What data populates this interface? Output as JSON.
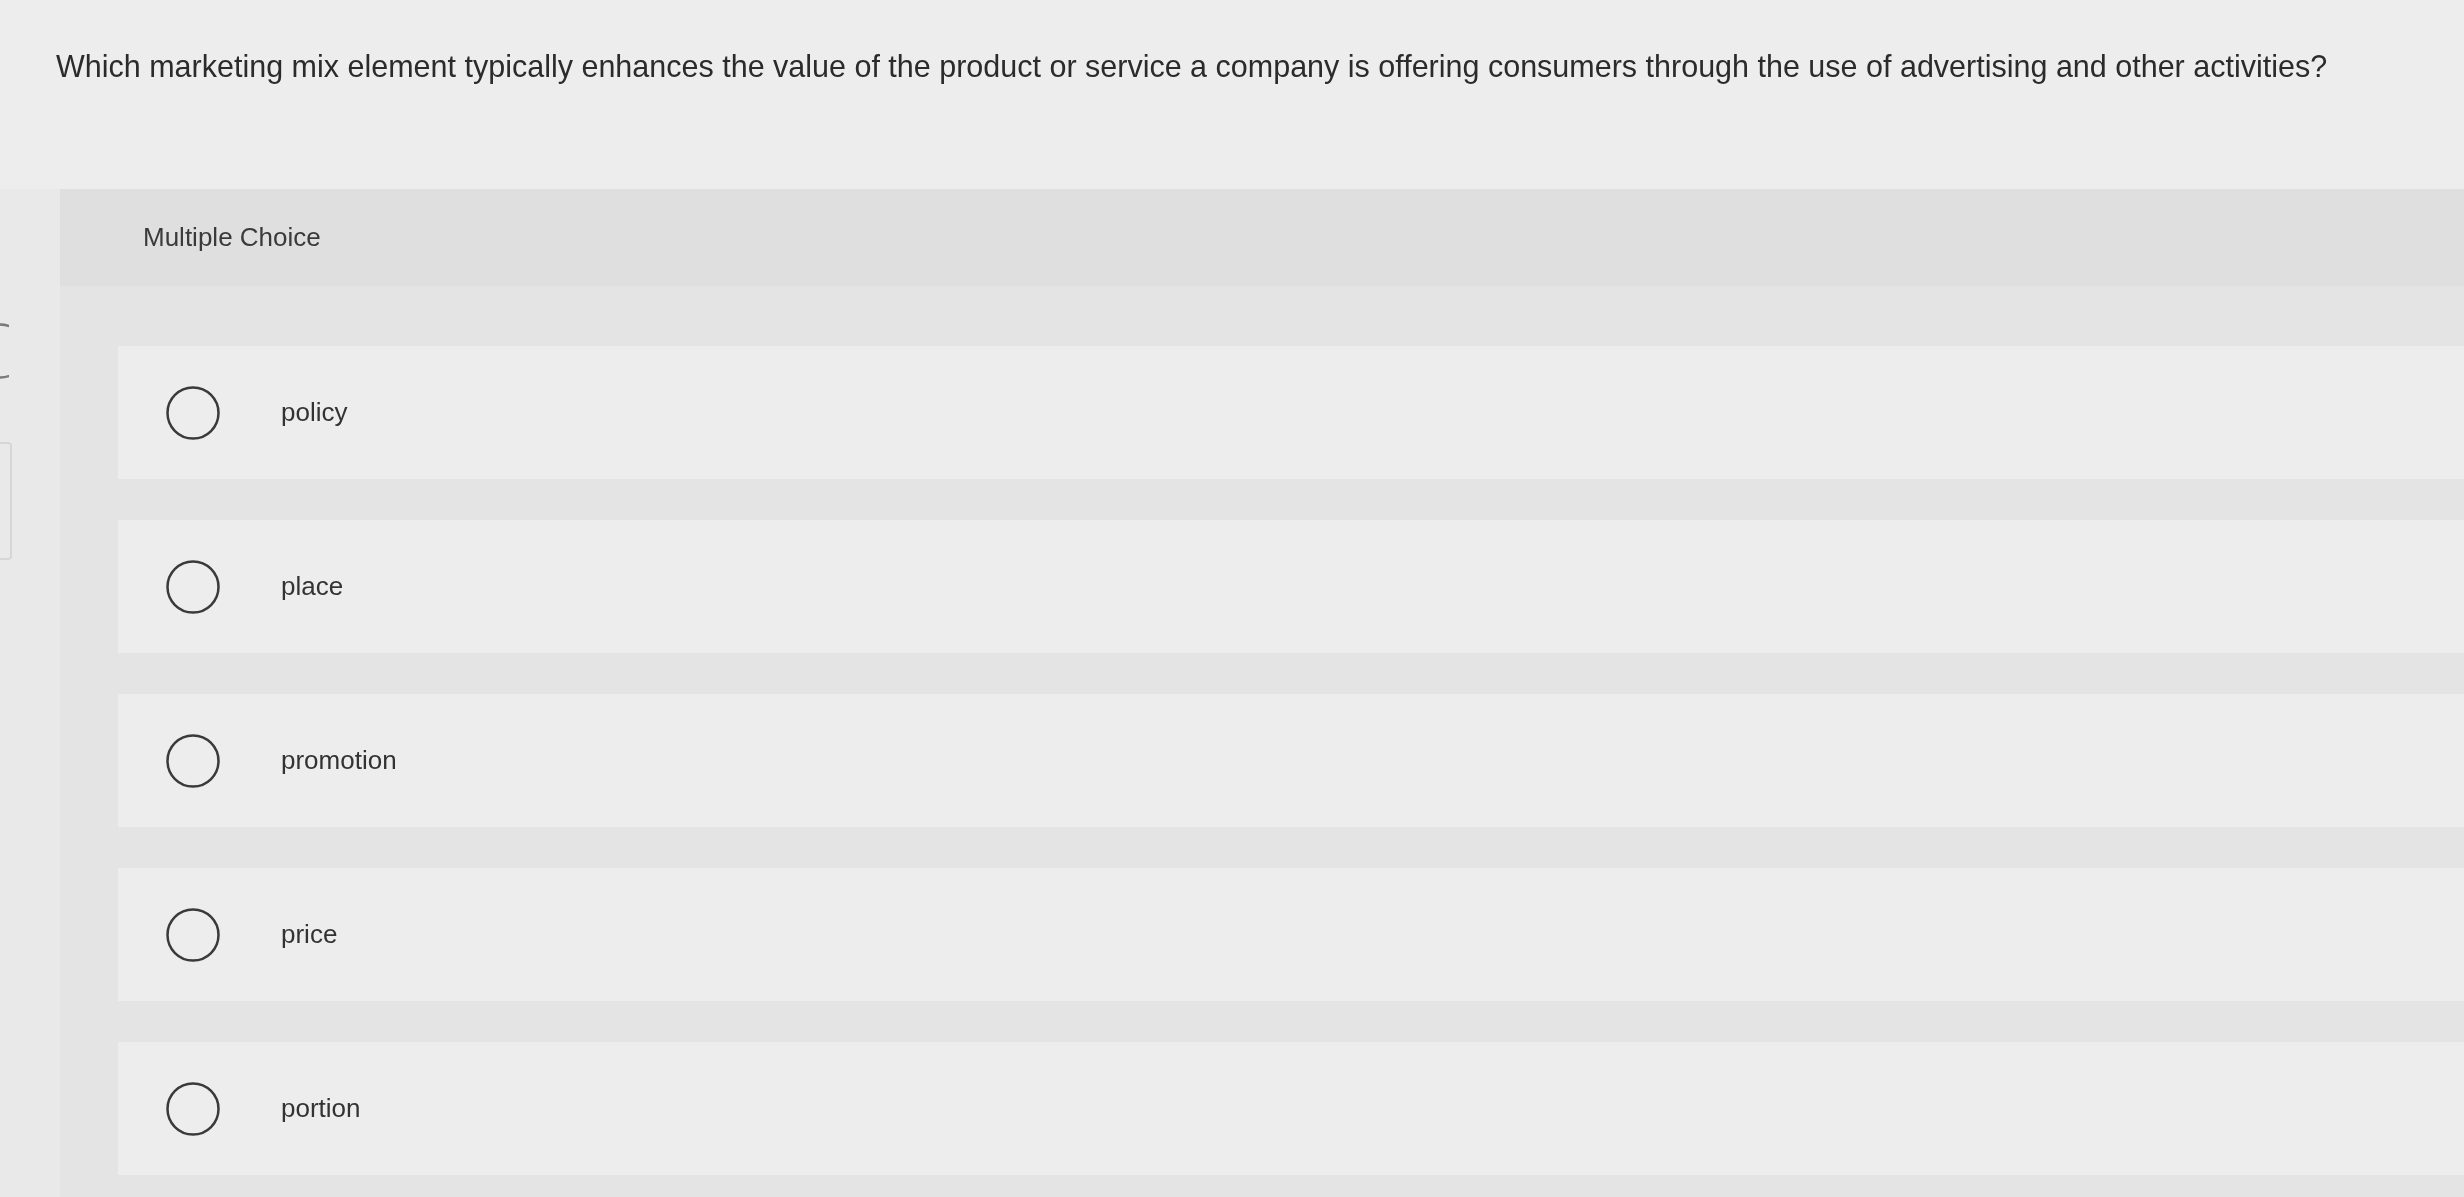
{
  "question": "Which marketing mix element typically enhances the value of the product or service a company is offering consumers through the use of advertising and other activities?",
  "question_type": "Multiple Choice",
  "options": [
    {
      "label": "policy",
      "selected": false
    },
    {
      "label": "place",
      "selected": false
    },
    {
      "label": "promotion",
      "selected": false
    },
    {
      "label": "price",
      "selected": false
    },
    {
      "label": "portion",
      "selected": false
    }
  ]
}
